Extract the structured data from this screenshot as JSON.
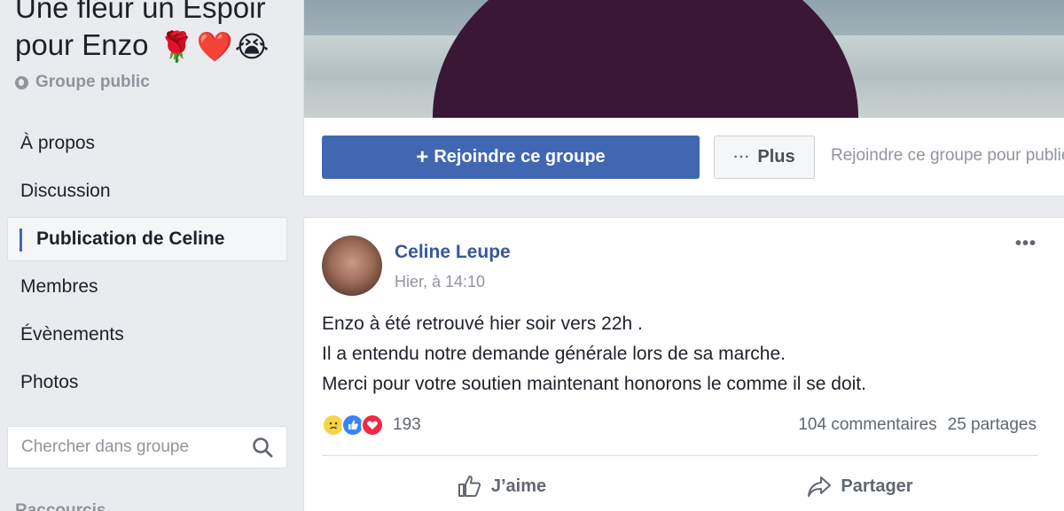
{
  "group": {
    "title": "Une fleur un Espoir pour Enzo",
    "title_emojis": [
      "🌹",
      "❤️",
      "😭"
    ],
    "type": "Groupe public"
  },
  "nav": {
    "items": [
      {
        "label": "À propos"
      },
      {
        "label": "Discussion"
      },
      {
        "label": "Publication de Celine",
        "active": true
      },
      {
        "label": "Membres"
      },
      {
        "label": "Évènements"
      },
      {
        "label": "Photos"
      }
    ]
  },
  "search": {
    "placeholder": "Chercher dans groupe"
  },
  "shortcuts_label": "Raccourcis",
  "header_actions": {
    "join_label": "Rejoindre ce groupe",
    "join_icon": "+",
    "more_label": "Plus",
    "more_icon": "···",
    "join_hint": "Rejoindre ce groupe pour publier"
  },
  "post": {
    "author": "Celine Leupe",
    "timestamp": "Hier, à 14:10",
    "menu_icon": "•••",
    "lines": [
      "Enzo à été retrouvé hier soir vers 22h .",
      "Il a entendu notre demande générale lors de sa marche.",
      "Merci pour votre soutien maintenant honorons le comme il se doit."
    ],
    "reactions": [
      "sad",
      "like",
      "love"
    ],
    "reaction_count": "193",
    "comments": "104 commentaires",
    "shares": "25 partages",
    "like_label": "J’aime",
    "share_label": "Partager"
  },
  "colors": {
    "brand": "#4267b2",
    "link": "#365899",
    "background": "#e9ebee"
  }
}
